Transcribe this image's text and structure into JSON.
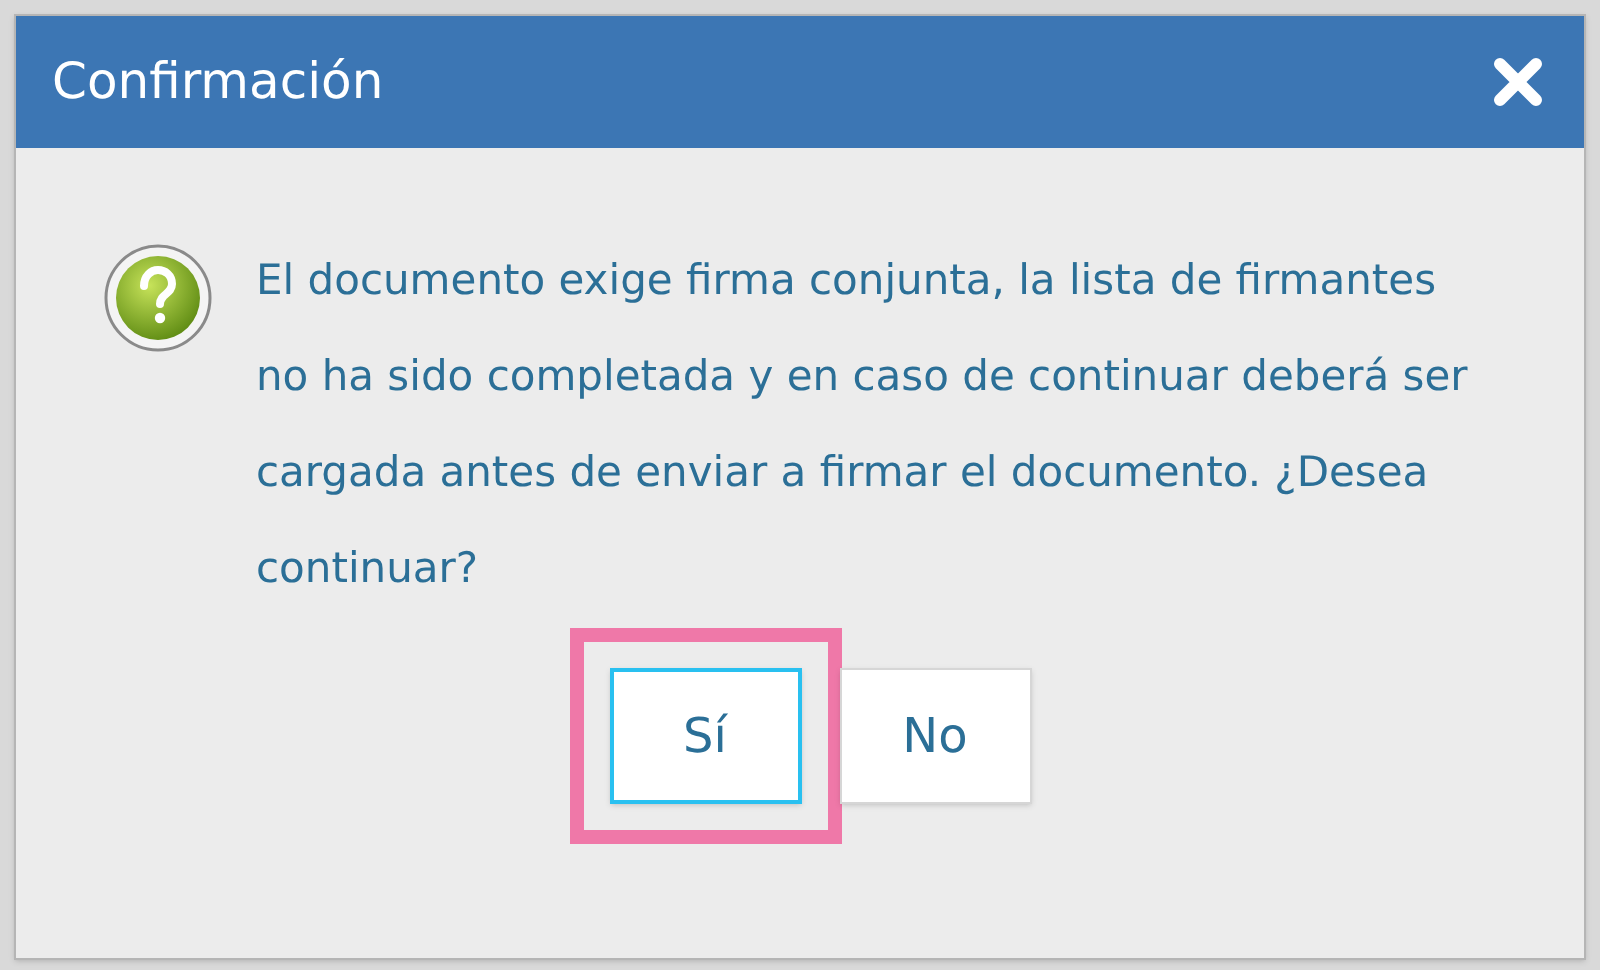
{
  "dialog": {
    "title": "Confirmación",
    "message": "El documento exige firma conjunta, la lista de firmantes no ha sido completada y en caso de continuar deberá ser cargada antes de enviar a firmar el documento. ¿Desea continuar?",
    "buttons": [
      {
        "label": "Sí",
        "focused": true,
        "highlighted": true
      },
      {
        "label": "No",
        "focused": false,
        "highlighted": false
      }
    ]
  }
}
